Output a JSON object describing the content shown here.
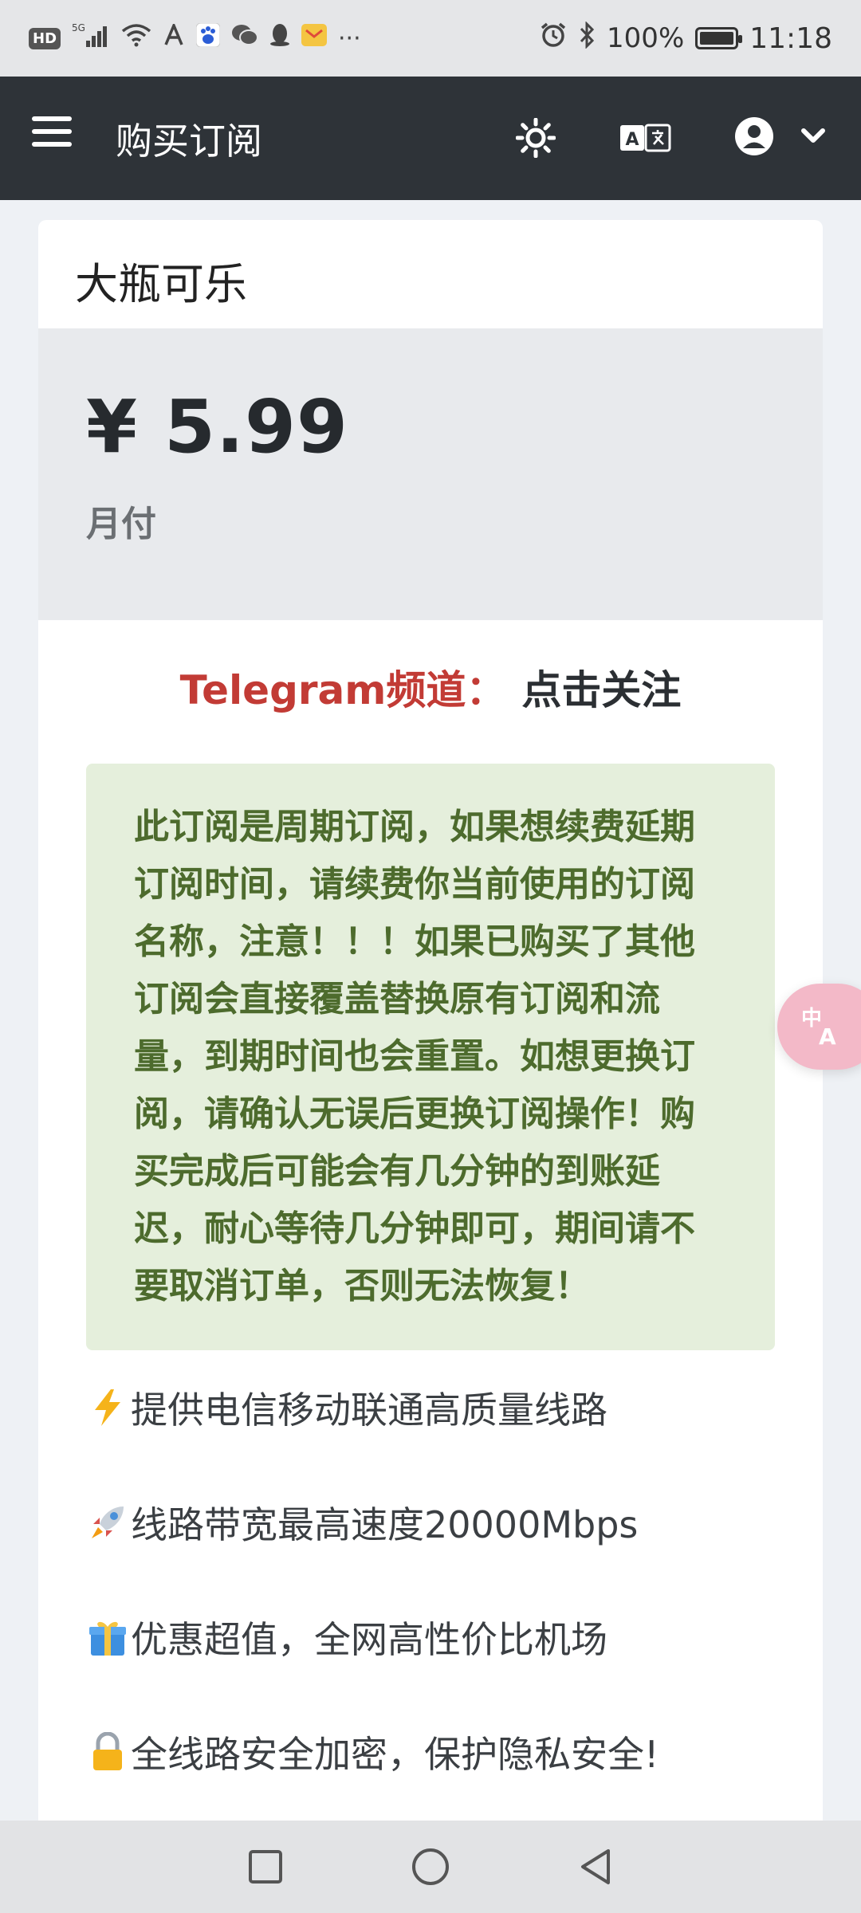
{
  "status_bar": {
    "hd": "HD",
    "network": "5G",
    "more": "···",
    "battery_pct": "100%",
    "time": "11:18",
    "icons": [
      "hd-icon",
      "signal-icon",
      "wifi-icon",
      "app-a-icon",
      "baidu-icon",
      "wechat-icon",
      "qq-icon",
      "mail-icon",
      "more-icon",
      "alarm-icon",
      "bluetooth-icon",
      "battery-icon"
    ]
  },
  "app_bar": {
    "title": "购买订阅",
    "icons": [
      "menu-icon",
      "sun-icon",
      "translate-icon",
      "account-icon",
      "chevron-down-icon"
    ]
  },
  "plan": {
    "name": "大瓶可乐",
    "price": "¥ 5.99",
    "period": "月付"
  },
  "telegram": {
    "label": "Telegram频道：",
    "link_text": "点击关注"
  },
  "notice": {
    "text": "此订阅是周期订阅，如果想续费延期订阅时间，请续费你当前使用的订阅名称，注意！！！如果已购买了其他订阅会直接覆盖替换原有订阅和流量，到期时间也会重置。如想更换订阅，请确认无误后更换订阅操作！购买完成后可能会有几分钟的到账延迟，耐心等待几分钟即可，期间请不要取消订单，否则无法恢复！"
  },
  "features": [
    {
      "icon": "lightning-icon",
      "text": "提供电信移动联通高质量线路"
    },
    {
      "icon": "rocket-icon",
      "text": "线路带宽最高速度20000Mbps"
    },
    {
      "icon": "gift-icon",
      "text": "优惠超值，全网高性价比机场"
    },
    {
      "icon": "lock-icon",
      "text": "全线路安全加密，保护隐私安全!"
    }
  ],
  "colors": {
    "app_bar_bg": "#2e3338",
    "telegram_label": "#c23b35",
    "notice_bg": "#e5efdc",
    "notice_text": "#4d6b2d",
    "price_bg": "#e8eaed"
  }
}
